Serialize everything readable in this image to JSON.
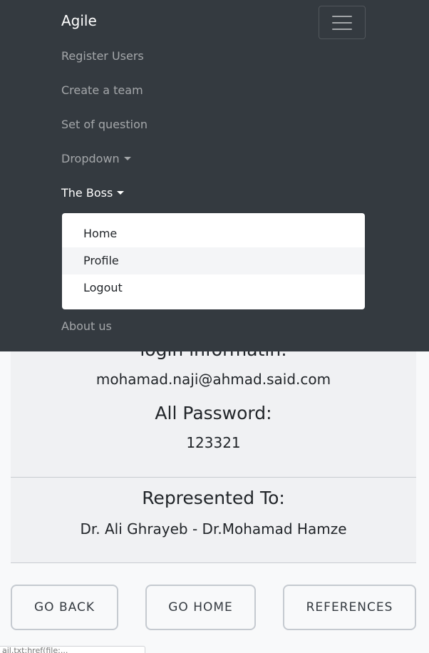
{
  "navbar": {
    "brand": "Agile",
    "items": [
      {
        "label": "Register Users"
      },
      {
        "label": "Create a team"
      },
      {
        "label": "Set of question"
      },
      {
        "label": "Dropdown"
      },
      {
        "label": "The Boss"
      },
      {
        "label": "About us"
      }
    ],
    "user_menu": [
      "Home",
      "Profile",
      "Logout"
    ]
  },
  "content": {
    "login_heading": "login informatin:",
    "email": "mohamad.naji@ahmad.said.com",
    "password_heading": "All Password:",
    "password": "123321",
    "represented_heading": "Represented To:",
    "represented_names": "Dr. Ali Ghrayeb - Dr.Mohamad Hamze"
  },
  "buttons": {
    "back": "GO BACK",
    "home": "GO HOME",
    "references": "REFERENCES"
  },
  "status_bar": "ail.txt:href(file:..."
}
